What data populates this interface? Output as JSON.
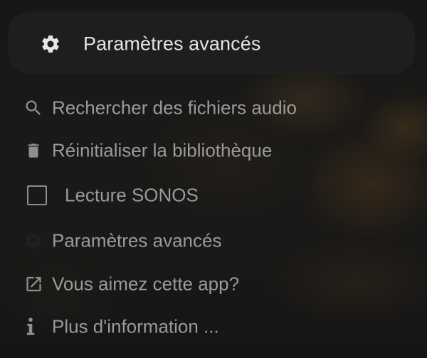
{
  "menu": {
    "header": {
      "label": "Paramètres avancés",
      "icon": "gear-icon"
    },
    "items": [
      {
        "label": "Rechercher des fichiers audio",
        "icon": "search-icon"
      },
      {
        "label": "Réinitialiser la bibliothèque",
        "icon": "trash-icon"
      },
      {
        "label": "Lecture SONOS",
        "icon": "checkbox",
        "checked": false
      },
      {
        "label": "Paramètres avancés",
        "icon": "gear-icon"
      },
      {
        "label": "Vous aimez cette app?",
        "icon": "external-link-icon"
      },
      {
        "label": "Plus d'information ...",
        "icon": "info-icon"
      }
    ]
  },
  "colors": {
    "header_bg": "#1e1e1e",
    "header_text": "#e4e4e4",
    "item_text": "#9a9a9a"
  }
}
